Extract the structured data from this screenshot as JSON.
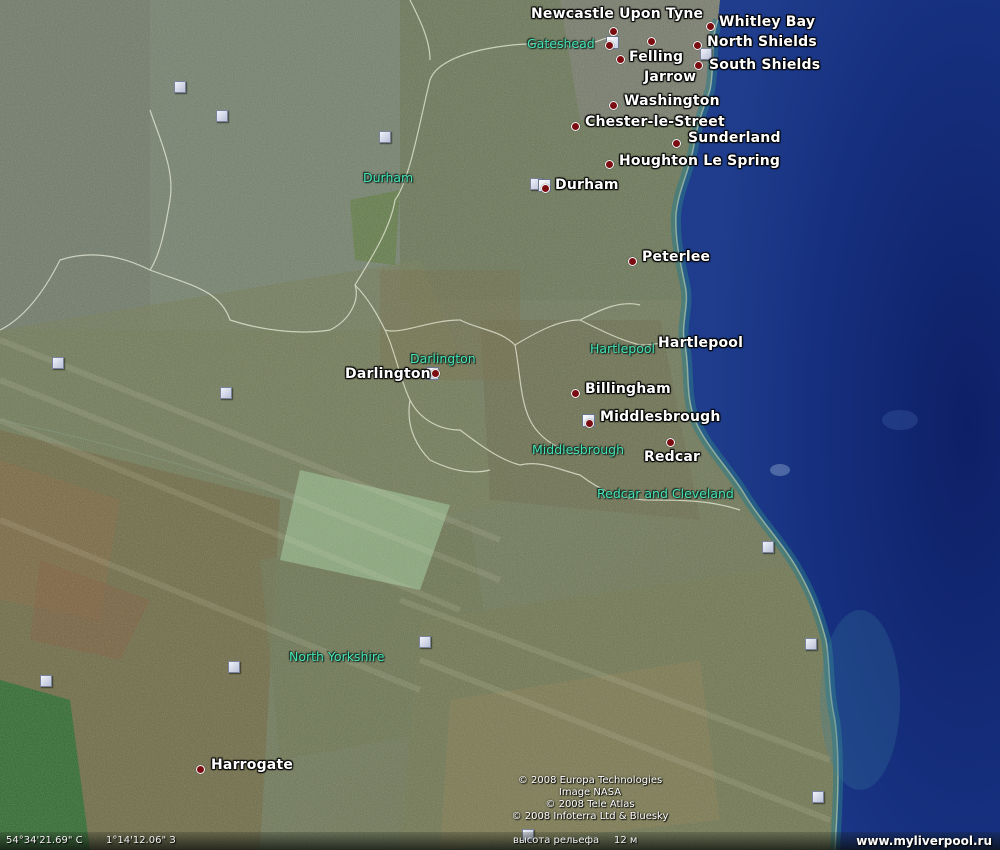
{
  "map": {
    "cities": [
      {
        "id": "newcastle-upon-tyne",
        "name": "Newcastle Upon Tyne"
      },
      {
        "id": "whitley-bay",
        "name": "Whitley Bay"
      },
      {
        "id": "north-shields",
        "name": "North Shields"
      },
      {
        "id": "felling",
        "name": "Felling"
      },
      {
        "id": "south-shields",
        "name": "South Shields"
      },
      {
        "id": "jarrow",
        "name": "Jarrow"
      },
      {
        "id": "washington",
        "name": "Washington"
      },
      {
        "id": "chester-le-street",
        "name": "Chester-le-Street"
      },
      {
        "id": "sunderland",
        "name": "Sunderland"
      },
      {
        "id": "houghton-le-spring",
        "name": "Houghton Le Spring"
      },
      {
        "id": "durham",
        "name": "Durham"
      },
      {
        "id": "peterlee",
        "name": "Peterlee"
      },
      {
        "id": "hartlepool",
        "name": "Hartlepool"
      },
      {
        "id": "darlington",
        "name": "Darlington"
      },
      {
        "id": "billingham",
        "name": "Billingham"
      },
      {
        "id": "middlesbrough",
        "name": "Middlesbrough"
      },
      {
        "id": "redcar",
        "name": "Redcar"
      },
      {
        "id": "harrogate",
        "name": "Harrogate"
      }
    ],
    "regions": [
      {
        "id": "gateshead",
        "name": "Gateshead"
      },
      {
        "id": "durham",
        "name": "Durham"
      },
      {
        "id": "darlington",
        "name": "Darlington"
      },
      {
        "id": "hartlepool",
        "name": "Hartlepool"
      },
      {
        "id": "middlesbrough",
        "name": "Middlesbrough"
      },
      {
        "id": "redcar-and-cleveland",
        "name": "Redcar and Cleveland"
      },
      {
        "id": "north-yorkshire",
        "name": "North Yorkshire"
      }
    ],
    "icon_names": [
      "photo-marker-icon",
      "admin-marker-icon",
      "city-dot-icon"
    ],
    "colors": {
      "region_label": "#47e3b5",
      "city_dot": "#7a0c12",
      "sea": "#142a78",
      "border_line": "#e8ecd8"
    }
  },
  "attribution": {
    "line1": "© 2008 Europa Technologies",
    "line2": "Image NASA",
    "line3": "© 2008 Tele Atlas",
    "line4": "© 2008 Infoterra Ltd & Bluesky"
  },
  "status_bar": {
    "latitude": "54°34'21.69\" С",
    "longitude": "1°14'12.06\" З",
    "elevation_label": "высота рельефа",
    "elevation_value": "12 м"
  },
  "watermark": "www.myliverpool.ru"
}
